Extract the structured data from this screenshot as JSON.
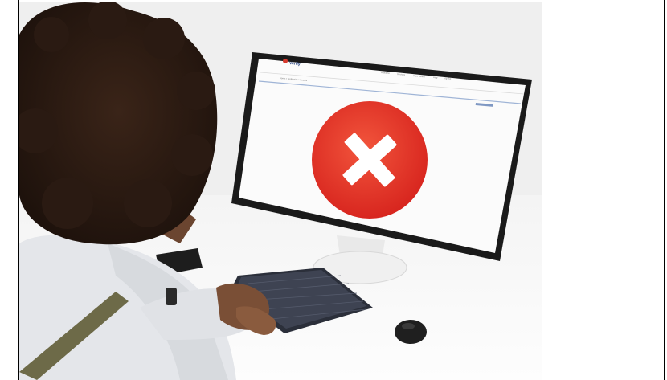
{
  "photo": {
    "scene": "person-at-desktop-computer",
    "screen": {
      "brand_label": "Verify",
      "nav_items": [
        "Welcome",
        "Services",
        "Case Details",
        "Help",
        "Log Out"
      ],
      "breadcrumb": "Home > Verification > Results",
      "status_icon": "error-x-icon",
      "status_color": "#e8392d"
    }
  }
}
